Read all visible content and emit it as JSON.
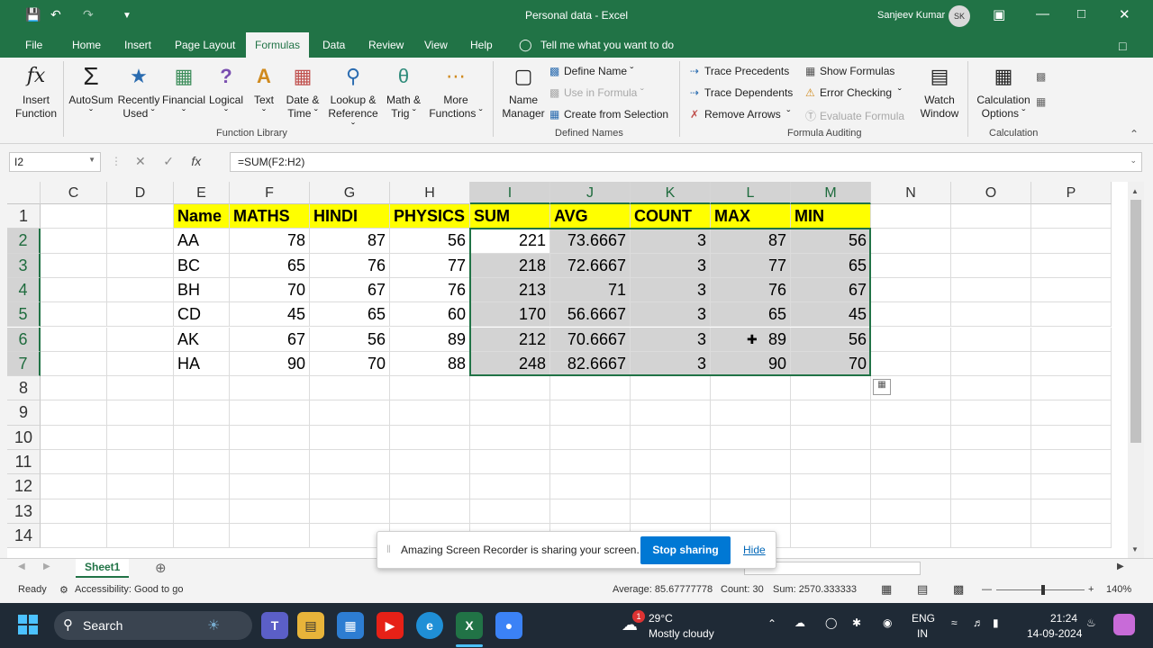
{
  "window": {
    "title": "Personal data  -  Excel",
    "user": "Sanjeev Kumar",
    "avatar": "SK"
  },
  "tabs": [
    "File",
    "Home",
    "Insert",
    "Page Layout",
    "Formulas",
    "Data",
    "Review",
    "View",
    "Help"
  ],
  "active_tab": "Formulas",
  "tell_me": "Tell me what you want to do",
  "ribbon": {
    "insert_function": [
      "Insert",
      "Function"
    ],
    "autosum": "AutoSum",
    "recently_used": [
      "Recently",
      "Used"
    ],
    "financial": "Financial",
    "logical": "Logical",
    "text": "Text",
    "date_time": [
      "Date &",
      "Time"
    ],
    "lookup": [
      "Lookup &",
      "Reference"
    ],
    "math": [
      "Math &",
      "Trig"
    ],
    "more": [
      "More",
      "Functions"
    ],
    "group_function_library": "Function Library",
    "name_manager": [
      "Name",
      "Manager"
    ],
    "define_name": "Define Name",
    "use_in_formula": "Use in Formula",
    "create_from_selection": "Create from Selection",
    "group_defined_names": "Defined Names",
    "trace_precedents": "Trace Precedents",
    "trace_dependents": "Trace Dependents",
    "remove_arrows": "Remove Arrows",
    "show_formulas": "Show Formulas",
    "error_checking": "Error Checking",
    "evaluate_formula": "Evaluate Formula",
    "watch_window": [
      "Watch",
      "Window"
    ],
    "group_formula_auditing": "Formula Auditing",
    "calc_options": [
      "Calculation",
      "Options"
    ],
    "group_calculation": "Calculation"
  },
  "name_box": "I2",
  "formula": "=SUM(F2:H2)",
  "columns": [
    "C",
    "D",
    "E",
    "F",
    "G",
    "H",
    "I",
    "J",
    "K",
    "L",
    "M",
    "N",
    "O",
    "P"
  ],
  "rows": [
    "1",
    "2",
    "3",
    "4",
    "5",
    "6",
    "7",
    "8",
    "9",
    "10",
    "11",
    "12",
    "13",
    "14"
  ],
  "headers": [
    "Name",
    "MATHS",
    "HINDI",
    "PHYSICS",
    "SUM",
    "AVG",
    "COUNT",
    "MAX",
    "MIN"
  ],
  "data": [
    [
      "AA",
      "78",
      "87",
      "56",
      "221",
      "73.6667",
      "3",
      "87",
      "56"
    ],
    [
      "BC",
      "65",
      "76",
      "77",
      "218",
      "72.6667",
      "3",
      "77",
      "65"
    ],
    [
      "BH",
      "70",
      "67",
      "76",
      "213",
      "71",
      "3",
      "76",
      "67"
    ],
    [
      "CD",
      "45",
      "65",
      "60",
      "170",
      "56.6667",
      "3",
      "65",
      "45"
    ],
    [
      "AK",
      "67",
      "56",
      "89",
      "212",
      "70.6667",
      "3",
      "89",
      "56"
    ],
    [
      "HA",
      "90",
      "70",
      "88",
      "248",
      "82.6667",
      "3",
      "90",
      "70"
    ]
  ],
  "sheet": "Sheet1",
  "status": {
    "ready": "Ready",
    "accessibility": "Accessibility: Good to go",
    "average": "Average: 85.67777778",
    "count": "Count: 30",
    "sum": "Sum: 2570.333333",
    "zoom": "140%"
  },
  "share_banner": {
    "message": "Amazing Screen Recorder is sharing your screen.",
    "stop": "Stop sharing",
    "hide": "Hide"
  },
  "taskbar": {
    "search": "Search",
    "weather_temp": "29°C",
    "weather_desc": "Mostly cloudy",
    "lang": "ENG",
    "region": "IN",
    "time": "21:24",
    "date": "14-09-2024",
    "notif": "1"
  },
  "colors": {
    "excel_green": "#217346",
    "header_fill": "#ffff00",
    "selection": "#d3d3d3"
  }
}
